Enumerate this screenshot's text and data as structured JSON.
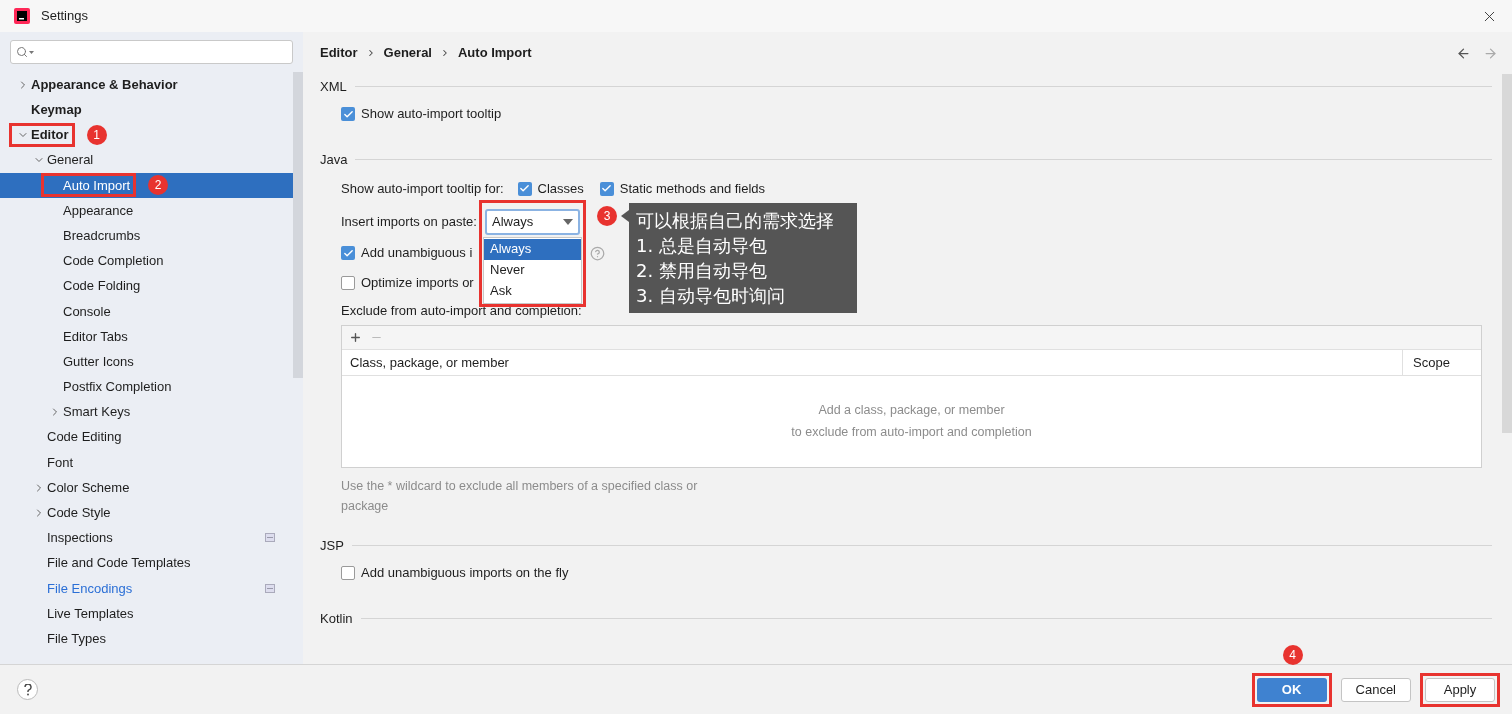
{
  "window": {
    "title": "Settings"
  },
  "sidebar": {
    "tree": [
      {
        "label": "Appearance & Behavior",
        "expanded": false,
        "selected": false
      },
      {
        "label": "Keymap",
        "selected": false
      },
      {
        "label": "Editor",
        "expanded": true,
        "selected": false,
        "highlighted": true,
        "badge": "1",
        "children": [
          {
            "label": "General",
            "expanded": true,
            "selected": false,
            "children": [
              {
                "label": "Auto Import",
                "selected": true,
                "highlighted": true,
                "badge": "2"
              },
              {
                "label": "Appearance",
                "selected": false
              },
              {
                "label": "Breadcrumbs",
                "selected": false
              },
              {
                "label": "Code Completion",
                "selected": false
              },
              {
                "label": "Code Folding",
                "selected": false
              },
              {
                "label": "Console",
                "selected": false
              },
              {
                "label": "Editor Tabs",
                "selected": false
              },
              {
                "label": "Gutter Icons",
                "selected": false
              },
              {
                "label": "Postfix Completion",
                "selected": false
              },
              {
                "label": "Smart Keys",
                "expanded": false,
                "selected": false
              }
            ]
          },
          {
            "label": "Code Editing",
            "selected": false
          },
          {
            "label": "Font",
            "selected": false
          },
          {
            "label": "Color Scheme",
            "expanded": false,
            "selected": false
          },
          {
            "label": "Code Style",
            "expanded": false,
            "selected": false
          },
          {
            "label": "Inspections",
            "selected": false,
            "project_icon": true
          },
          {
            "label": "File and Code Templates",
            "selected": false
          },
          {
            "label": "File Encodings",
            "selected": false,
            "modified": true,
            "project_icon": true
          },
          {
            "label": "Live Templates",
            "selected": false
          },
          {
            "label": "File Types",
            "selected": false
          }
        ]
      }
    ]
  },
  "breadcrumb": [
    "Editor",
    "General",
    "Auto Import"
  ],
  "sections": [
    {
      "title": "XML",
      "rows": [
        {
          "kind": "checkbox",
          "label": "Show auto-import tooltip",
          "checked": true
        }
      ]
    },
    {
      "title": "Java",
      "rows": [
        {
          "kind": "checkgroup",
          "label": "Show auto-import tooltip for:",
          "options": [
            {
              "label": "Classes",
              "checked": true
            },
            {
              "label": "Static methods and fields",
              "checked": true
            }
          ]
        },
        {
          "kind": "dropdown",
          "label": "Insert imports on paste:",
          "value": "Always",
          "highlighted": true,
          "options": [
            {
              "label": "Always",
              "selected": true
            },
            {
              "label": "Never",
              "selected": false
            },
            {
              "label": "Ask",
              "selected": false
            }
          ],
          "callout": {
            "badge": "3",
            "lines": [
              "可以根据自己的需求选择",
              "1. 总是自动导包",
              "2. 禁用自动导包",
              "3. 自动导包时询问"
            ]
          }
        },
        {
          "kind": "checkbox",
          "label": "Add unambiguous i",
          "checked": true,
          "help": true
        },
        {
          "kind": "checkbox",
          "label": "Optimize imports or",
          "checked": false
        },
        {
          "kind": "label",
          "label": "Exclude from auto-import and completion:"
        },
        {
          "kind": "table",
          "columns": [
            "Class, package, or member",
            "Scope"
          ],
          "empty_text": [
            "Add a class, package, or member",
            "to exclude from auto-import and completion"
          ]
        },
        {
          "kind": "hint",
          "label": "Use the * wildcard to exclude all members of a specified class or package"
        }
      ]
    },
    {
      "title": "JSP",
      "rows": [
        {
          "kind": "checkbox",
          "label": "Add unambiguous imports on the fly",
          "checked": false
        }
      ]
    },
    {
      "title": "Kotlin"
    }
  ],
  "buttons": [
    {
      "label": "OK",
      "kind": "primary",
      "highlighted": true,
      "badge": "4"
    },
    {
      "label": "Cancel",
      "kind": "secondary",
      "highlighted": false
    },
    {
      "label": "Apply",
      "kind": "secondary",
      "highlighted": true
    }
  ]
}
